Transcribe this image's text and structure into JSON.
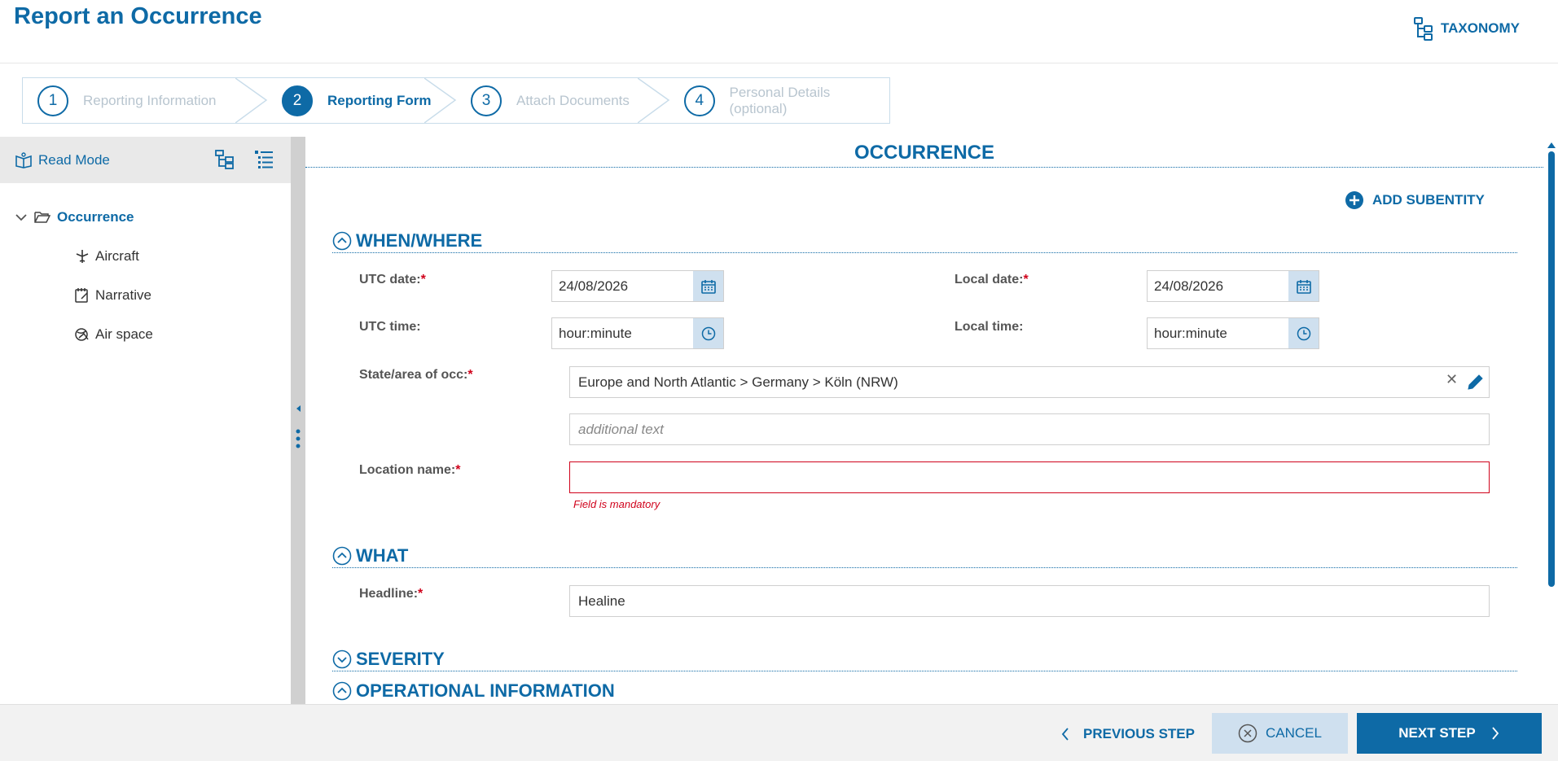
{
  "header": {
    "title": "Report an Occurrence",
    "taxonomy_label": "TAXONOMY"
  },
  "stepper": [
    {
      "num": "1",
      "label": "Reporting Information",
      "active": false
    },
    {
      "num": "2",
      "label": "Reporting Form",
      "active": true
    },
    {
      "num": "3",
      "label": "Attach Documents",
      "active": false
    },
    {
      "num": "4",
      "label": "Personal Details (optional)",
      "active": false
    }
  ],
  "sidebar": {
    "read_mode": "Read Mode",
    "root": "Occurrence",
    "items": [
      {
        "label": "Aircraft",
        "icon": "aircraft-icon"
      },
      {
        "label": "Narrative",
        "icon": "narrative-icon"
      },
      {
        "label": "Air space",
        "icon": "airspace-icon"
      }
    ]
  },
  "main": {
    "section_title": "OCCURRENCE",
    "add_subentity": "ADD SUBENTITY",
    "groups": {
      "when_where": "WHEN/WHERE",
      "what": "WHAT",
      "severity": "SEVERITY",
      "operational": "OPERATIONAL INFORMATION"
    },
    "fields": {
      "utc_date": {
        "label": "UTC date:",
        "value": "24/08/2026"
      },
      "local_date": {
        "label": "Local date:",
        "value": "24/08/2026"
      },
      "utc_time": {
        "label": "UTC time:",
        "value": "hour:minute"
      },
      "local_time": {
        "label": "Local time:",
        "value": "hour:minute"
      },
      "state_area": {
        "label": "State/area of occ:",
        "value": "Europe and North Atlantic > Germany > Köln (NRW)",
        "additional_placeholder": "additional text"
      },
      "location_name": {
        "label": "Location name:",
        "value": "",
        "error": "Field is mandatory"
      },
      "headline": {
        "label": "Headline:",
        "value": "Healine"
      }
    },
    "required_mark": "*"
  },
  "footer": {
    "previous": "PREVIOUS STEP",
    "cancel": "CANCEL",
    "next": "NEXT STEP"
  },
  "colors": {
    "accent": "#0e6aa6",
    "error": "#d0021b",
    "light_button": "#cfe0ef"
  }
}
